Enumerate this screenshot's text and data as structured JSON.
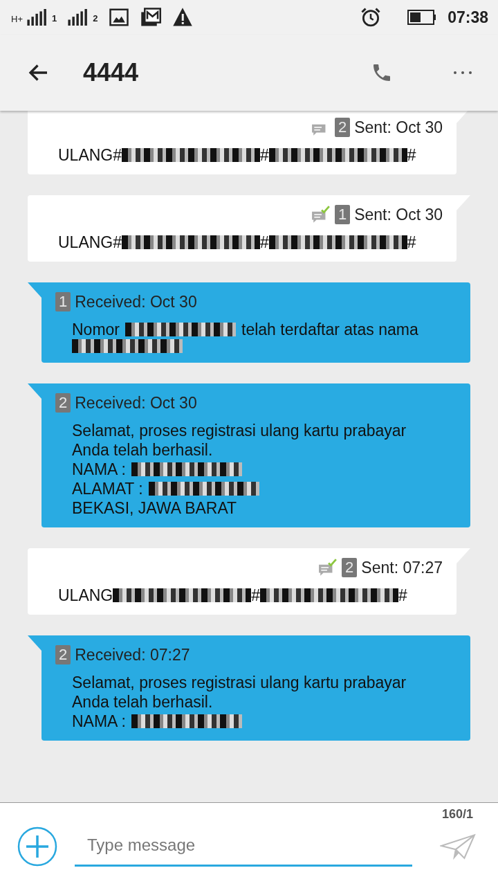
{
  "status_bar": {
    "network": "H+",
    "sim_labels": [
      "1",
      "2"
    ],
    "time": "07:38"
  },
  "header": {
    "title": "4444"
  },
  "messages": [
    {
      "kind": "sent",
      "sim": "2",
      "delivered": false,
      "meta": "Sent: Oct 30",
      "lines": [
        [
          {
            "kind": "text",
            "text": "ULANG#"
          },
          {
            "kind": "redacted"
          },
          {
            "kind": "text",
            "text": "#"
          },
          {
            "kind": "redacted"
          },
          {
            "kind": "text",
            "text": "#"
          }
        ]
      ]
    },
    {
      "kind": "sent",
      "sim": "1",
      "delivered": true,
      "meta": "Sent: Oct 30",
      "lines": [
        [
          {
            "kind": "text",
            "text": "ULANG#"
          },
          {
            "kind": "redacted"
          },
          {
            "kind": "text",
            "text": "#"
          },
          {
            "kind": "redacted"
          },
          {
            "kind": "text",
            "text": "#"
          }
        ]
      ]
    },
    {
      "kind": "received",
      "sim": "1",
      "meta": "Received: Oct 30",
      "lines": [
        [
          {
            "kind": "text",
            "text": "Nomor"
          },
          {
            "kind": "redacted"
          },
          {
            "kind": "text",
            "text": "telah terdaftar atas nama"
          }
        ],
        [
          {
            "kind": "redacted"
          }
        ]
      ]
    },
    {
      "kind": "received",
      "sim": "2",
      "meta": "Received: Oct 30",
      "lines": [
        [
          {
            "kind": "text",
            "text": "Selamat, proses registrasi ulang kartu prabayar"
          }
        ],
        [
          {
            "kind": "text",
            "text": "Anda telah berhasil."
          }
        ],
        [
          {
            "kind": "text",
            "text": "NAMA :"
          },
          {
            "kind": "redacted"
          }
        ],
        [
          {
            "kind": "text",
            "text": "ALAMAT :"
          },
          {
            "kind": "redacted"
          }
        ],
        [
          {
            "kind": "text",
            "text": "BEKASI, JAWA BARAT"
          }
        ]
      ]
    },
    {
      "kind": "sent",
      "sim": "2",
      "delivered": true,
      "meta": "Sent: 07:27",
      "lines": [
        [
          {
            "kind": "text",
            "text": "ULANG"
          },
          {
            "kind": "redacted"
          },
          {
            "kind": "text",
            "text": "#"
          },
          {
            "kind": "redacted"
          },
          {
            "kind": "text",
            "text": "#"
          }
        ]
      ]
    },
    {
      "kind": "received",
      "sim": "2",
      "meta": "Received: 07:27",
      "lines": [
        [
          {
            "kind": "text",
            "text": "Selamat, proses registrasi ulang kartu prabayar"
          }
        ],
        [
          {
            "kind": "text",
            "text": "Anda telah berhasil."
          }
        ],
        [
          {
            "kind": "text",
            "text": "NAMA :"
          },
          {
            "kind": "redacted"
          }
        ]
      ]
    }
  ],
  "composer": {
    "counter": "160/1",
    "placeholder": "Type message"
  }
}
